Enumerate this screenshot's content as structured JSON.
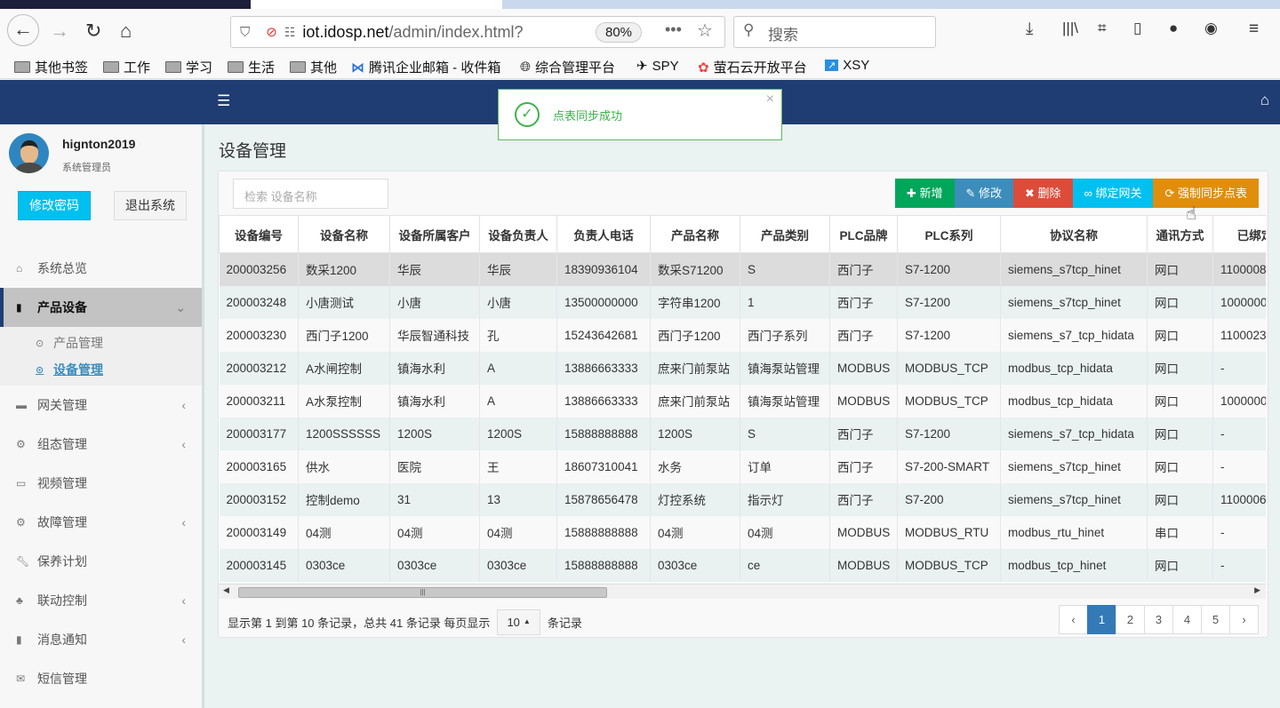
{
  "browser": {
    "url_host": "iot.idosp.net",
    "url_path": "/admin/index.html?",
    "zoom": "80%",
    "search_placeholder": "搜索",
    "bookmarks": [
      "其他书签",
      "工作",
      "学习",
      "生活",
      "其他",
      "腾讯企业邮箱 - 收件箱",
      "综合管理平台",
      "SPY",
      "萤石云开放平台",
      "XSY"
    ]
  },
  "user": {
    "name": "hignton2019",
    "role": "系统管理员",
    "change_password": "修改密码",
    "logout": "退出系统"
  },
  "sidebar": {
    "items": [
      {
        "label": "系统总览",
        "icon": "home-icon",
        "chevron": ""
      },
      {
        "label": "产品设备",
        "icon": "book-icon",
        "chevron": "⌄"
      },
      {
        "label": "网关管理",
        "icon": "gateway-icon",
        "chevron": "‹"
      },
      {
        "label": "组态管理",
        "icon": "cogs-icon",
        "chevron": "‹"
      },
      {
        "label": "视频管理",
        "icon": "monitor-icon",
        "chevron": ""
      },
      {
        "label": "故障管理",
        "icon": "cogs-icon",
        "chevron": "‹"
      },
      {
        "label": "保养计划",
        "icon": "wrench-icon",
        "chevron": ""
      },
      {
        "label": "联动控制",
        "icon": "sitemap-icon",
        "chevron": "‹"
      },
      {
        "label": "消息通知",
        "icon": "book-icon",
        "chevron": "‹"
      },
      {
        "label": "短信管理",
        "icon": "envelope-icon",
        "chevron": ""
      }
    ],
    "sub": [
      "产品管理",
      "设备管理"
    ]
  },
  "page": {
    "title": "设备管理",
    "search_placeholder": "检索 设备名称"
  },
  "actions": [
    {
      "label": "新增",
      "icon": "plus-icon",
      "color": "#00a65a"
    },
    {
      "label": "修改",
      "icon": "pencil-icon",
      "color": "#3c8dbc"
    },
    {
      "label": "删除",
      "icon": "times-icon",
      "color": "#dd4b39"
    },
    {
      "label": "绑定网关",
      "icon": "link-icon",
      "color": "#00c0ef"
    },
    {
      "label": "强制同步点表",
      "icon": "refresh-icon",
      "color": "#e08e0b"
    }
  ],
  "table": {
    "columns": [
      "设备编号",
      "设备名称",
      "设备所属客户",
      "设备负责人",
      "负责人电话",
      "产品名称",
      "产品类别",
      "PLC品牌",
      "PLC系列",
      "协议名称",
      "通讯方式",
      "已绑定网关"
    ],
    "rows": [
      [
        "200003256",
        "数采1200",
        "华辰",
        "华辰",
        "18390936104",
        "数采S71200",
        "S",
        "西门子",
        "S7-1200",
        "siemens_s7tcp_hinet",
        "网口",
        "1100008"
      ],
      [
        "200003248",
        "小唐测试",
        "小唐",
        "小唐",
        "13500000000",
        "字符串1200",
        "1",
        "西门子",
        "S7-1200",
        "siemens_s7tcp_hinet",
        "网口",
        "1000000"
      ],
      [
        "200003230",
        "西门子1200",
        "华辰智通科技",
        "孔",
        "15243642681",
        "西门子1200",
        "西门子系列",
        "西门子",
        "S7-1200",
        "siemens_s7_tcp_hidata",
        "网口",
        "1100023"
      ],
      [
        "200003212",
        "A水闸控制",
        "镇海水利",
        "A",
        "13886663333",
        "庶来门前泵站",
        "镇海泵站管理",
        "MODBUS",
        "MODBUS_TCP",
        "modbus_tcp_hidata",
        "网口",
        "-"
      ],
      [
        "200003211",
        "A水泵控制",
        "镇海水利",
        "A",
        "13886663333",
        "庶来门前泵站",
        "镇海泵站管理",
        "MODBUS",
        "MODBUS_TCP",
        "modbus_tcp_hidata",
        "网口",
        "1000000"
      ],
      [
        "200003177",
        "1200SSSSSS",
        "1200S",
        "1200S",
        "15888888888",
        "1200S",
        "S",
        "西门子",
        "S7-1200",
        "siemens_s7_tcp_hidata",
        "网口",
        "-"
      ],
      [
        "200003165",
        "供水",
        "医院",
        "王",
        "18607310041",
        "水务",
        "订单",
        "西门子",
        "S7-200-SMART",
        "siemens_s7tcp_hinet",
        "网口",
        "-"
      ],
      [
        "200003152",
        "控制demo",
        "31",
        "13",
        "15878656478",
        "灯控系统",
        "指示灯",
        "西门子",
        "S7-200",
        "siemens_s7tcp_hinet",
        "网口",
        "1100006"
      ],
      [
        "200003149",
        "04测",
        "04测",
        "04测",
        "15888888888",
        "04测",
        "04测",
        "MODBUS",
        "MODBUS_RTU",
        "modbus_rtu_hinet",
        "串口",
        "-"
      ],
      [
        "200003145",
        "0303ce",
        "0303ce",
        "0303ce",
        "15888888888",
        "0303ce",
        "ce",
        "MODBUS",
        "MODBUS_TCP",
        "modbus_tcp_hinet",
        "网口",
        "-"
      ]
    ]
  },
  "footer": {
    "text_before": "显示第 1 到第 10 条记录，总共 41 条记录 每页显示",
    "page_size": "10",
    "text_after": "条记录"
  },
  "pagination": {
    "prev": "‹",
    "pages": [
      "1",
      "2",
      "3",
      "4",
      "5"
    ],
    "current": "1",
    "next": "›"
  },
  "toast": {
    "message": "点表同步成功"
  }
}
